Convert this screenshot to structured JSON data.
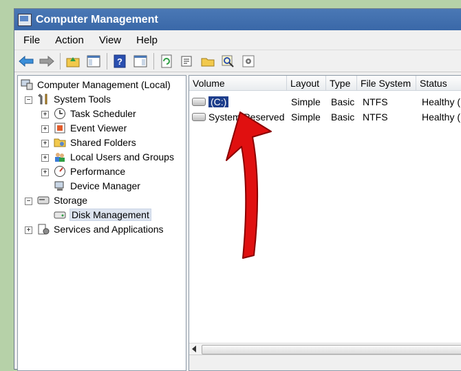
{
  "window": {
    "title": "Computer Management"
  },
  "menu": [
    "File",
    "Action",
    "View",
    "Help"
  ],
  "toolbar": {
    "icons": [
      "back-arrow-icon",
      "forward-arrow-icon",
      "up-folder-icon",
      "show-hide-tree-icon",
      "help-icon",
      "action-pane-icon",
      "refresh-icon",
      "properties-icon",
      "open-folder-icon",
      "search-icon",
      "settings-icon"
    ]
  },
  "tree": {
    "root": "Computer Management (Local)",
    "system_tools": "System Tools",
    "task_scheduler": "Task Scheduler",
    "event_viewer": "Event Viewer",
    "shared_folders": "Shared Folders",
    "local_users": "Local Users and Groups",
    "performance": "Performance",
    "device_manager": "Device Manager",
    "storage": "Storage",
    "disk_management": "Disk Management",
    "services": "Services and Applications"
  },
  "table": {
    "headers": [
      "Volume",
      "Layout",
      "Type",
      "File System",
      "Status"
    ],
    "rows": [
      {
        "volume": "(C:)",
        "layout": "Simple",
        "type": "Basic",
        "fs": "NTFS",
        "status": "Healthy ("
      },
      {
        "volume": "System Reserved",
        "layout": "Simple",
        "type": "Basic",
        "fs": "NTFS",
        "status": "Healthy ("
      }
    ]
  },
  "colors": {
    "selection": "#1d3e8c",
    "titlebar": "#3a68a8",
    "annotation_arrow": "#e01010"
  }
}
